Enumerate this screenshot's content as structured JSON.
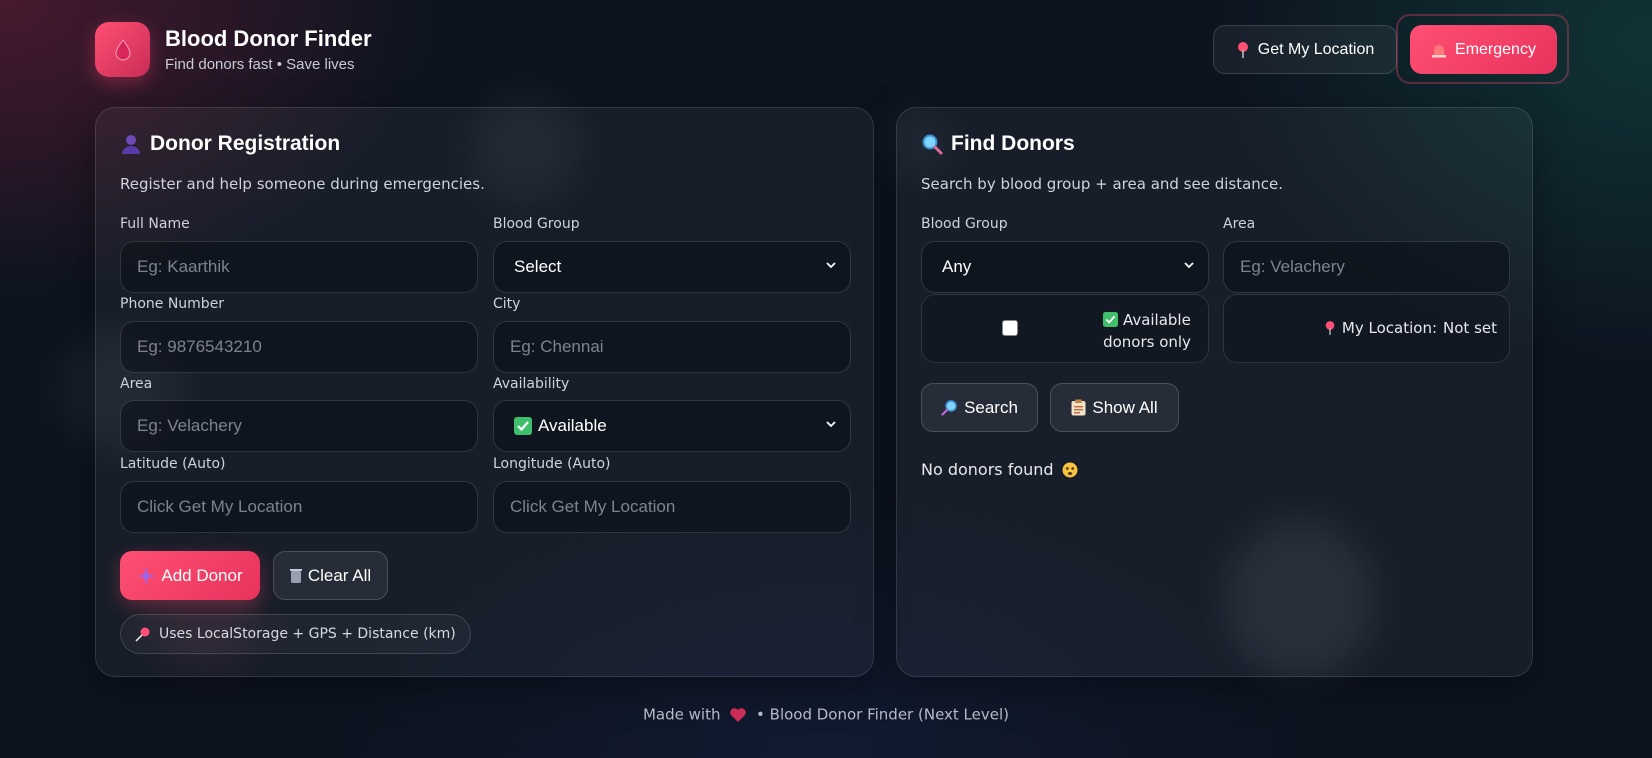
{
  "colors": {
    "accent": "#ff4f74",
    "accent_dark": "#e8335c",
    "background": "#0d1420"
  },
  "header": {
    "logo_icon": "blood-drop-icon",
    "title": "Blood Donor Finder",
    "subtitle": "Find donors fast • Save lives",
    "location_button": "Get My Location",
    "emergency_button": "Emergency"
  },
  "registration": {
    "title": "Donor Registration",
    "subtitle": "Register and help someone during emergencies.",
    "full_name": {
      "label": "Full Name",
      "placeholder": "Eg: Kaarthik"
    },
    "blood_group": {
      "label": "Blood Group",
      "value": "Select"
    },
    "phone": {
      "label": "Phone Number",
      "placeholder": "Eg: 9876543210"
    },
    "city": {
      "label": "City",
      "placeholder": "Eg: Chennai"
    },
    "area": {
      "label": "Area",
      "placeholder": "Eg: Velachery"
    },
    "availability": {
      "label": "Availability",
      "value": "Available"
    },
    "latitude": {
      "label": "Latitude (Auto)",
      "placeholder": "Click Get My Location"
    },
    "longitude": {
      "label": "Longitude (Auto)",
      "placeholder": "Click Get My Location"
    },
    "add_button": "Add Donor",
    "clear_button": "Clear All",
    "info_chip": "Uses LocalStorage + GPS + Distance (km)"
  },
  "search": {
    "title": "Find Donors",
    "subtitle": "Search by blood group + area and see distance.",
    "blood_group": {
      "label": "Blood Group",
      "value": "Any"
    },
    "area": {
      "label": "Area",
      "placeholder": "Eg: Velachery"
    },
    "available_only_label": "Available donors only",
    "my_location_label": "My Location:",
    "my_location_value": "Not set",
    "search_button": "Search",
    "show_all_button": "Show All",
    "empty_message": "No donors found"
  },
  "footer": {
    "prefix": "Made with",
    "suffix": "• Blood Donor Finder (Next Level)"
  }
}
